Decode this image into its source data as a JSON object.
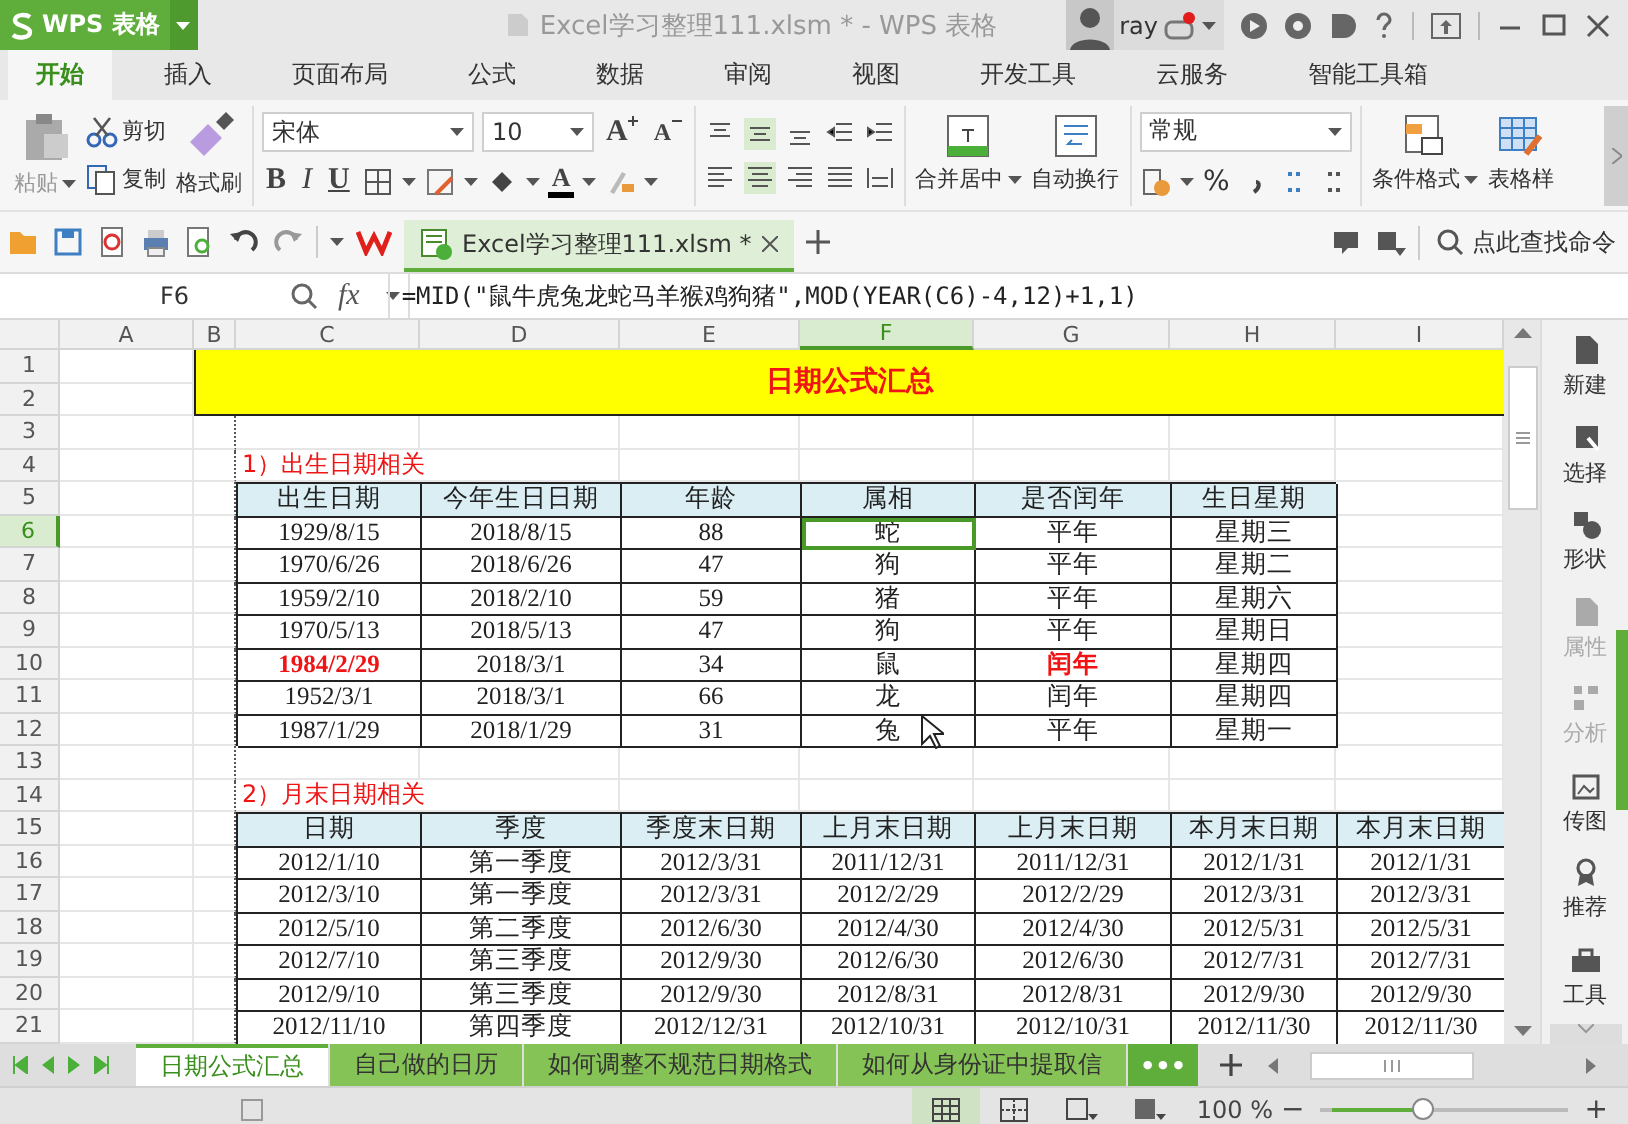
{
  "app": {
    "logo": "WPS 表格",
    "title": "Excel学习整理111.xlsm * - WPS 表格",
    "user": "ray"
  },
  "menu_tabs": [
    {
      "label": "开始",
      "selected": true
    },
    {
      "label": "插入",
      "selected": false
    },
    {
      "label": "页面布局",
      "selected": false
    },
    {
      "label": "公式",
      "selected": false
    },
    {
      "label": "数据",
      "selected": false
    },
    {
      "label": "审阅",
      "selected": false
    },
    {
      "label": "视图",
      "selected": false
    },
    {
      "label": "开发工具",
      "selected": false
    },
    {
      "label": "云服务",
      "selected": false
    },
    {
      "label": "智能工具箱",
      "selected": false
    }
  ],
  "ribbon": {
    "paste": "粘贴",
    "cut": "剪切",
    "copy": "复制",
    "format_painter": "格式刷",
    "font_name": "宋体",
    "font_size": "10",
    "grow_font": "A",
    "shrink_font": "A",
    "bold": "B",
    "italic": "I",
    "underline": "U",
    "font_color": "A",
    "merge_center": "合并居中",
    "wrap_text": "自动换行",
    "number_format": "常规",
    "percent": "%",
    "conditional_format": "条件格式",
    "table_style": "表格样"
  },
  "toolbar": {
    "document_tab": "Excel学习整理111.xlsm *",
    "search": "点此查找命令"
  },
  "formula_bar": {
    "cell": "F6",
    "fx": "fx",
    "formula": "=MID(\"鼠牛虎兔龙蛇马羊猴鸡狗猪\",MOD(YEAR(C6)-4,12)+1,1)"
  },
  "sheet": {
    "columns": [
      {
        "label": "A",
        "selected": false
      },
      {
        "label": "B",
        "selected": false
      },
      {
        "label": "C",
        "selected": false
      },
      {
        "label": "D",
        "selected": false
      },
      {
        "label": "E",
        "selected": false
      },
      {
        "label": "F",
        "selected": true
      },
      {
        "label": "G",
        "selected": false
      },
      {
        "label": "H",
        "selected": false
      },
      {
        "label": "I",
        "selected": false
      }
    ],
    "rows": [
      {
        "label": "1",
        "selected": false
      },
      {
        "label": "2",
        "selected": false
      },
      {
        "label": "3",
        "selected": false
      },
      {
        "label": "4",
        "selected": false
      },
      {
        "label": "5",
        "selected": false
      },
      {
        "label": "6",
        "selected": true
      },
      {
        "label": "7",
        "selected": false
      },
      {
        "label": "8",
        "selected": false
      },
      {
        "label": "9",
        "selected": false
      },
      {
        "label": "10",
        "selected": false
      },
      {
        "label": "11",
        "selected": false
      },
      {
        "label": "12",
        "selected": false
      },
      {
        "label": "13",
        "selected": false
      },
      {
        "label": "14",
        "selected": false
      },
      {
        "label": "15",
        "selected": false
      },
      {
        "label": "16",
        "selected": false
      },
      {
        "label": "17",
        "selected": false
      },
      {
        "label": "18",
        "selected": false
      },
      {
        "label": "19",
        "selected": false
      },
      {
        "label": "20",
        "selected": false
      },
      {
        "label": "21",
        "selected": false
      }
    ],
    "title": "日期公式汇总",
    "birthday_table": {
      "label": "1）出生日期相关",
      "headers": [
        "出生日期",
        "今年生日日期",
        "年龄",
        "属相",
        "是否闰年",
        "生日星期"
      ],
      "rows": [
        {
          "cells": [
            {
              "text": "1929/8/15",
              "highlighted": false,
              "selected": false
            },
            {
              "text": "2018/8/15",
              "highlighted": false,
              "selected": false
            },
            {
              "text": "88",
              "highlighted": false,
              "selected": false
            },
            {
              "text": "蛇",
              "highlighted": false,
              "selected": true
            },
            {
              "text": "平年",
              "highlighted": false,
              "selected": false
            },
            {
              "text": "星期三",
              "highlighted": false,
              "selected": false
            }
          ]
        },
        {
          "cells": [
            {
              "text": "1970/6/26",
              "highlighted": false,
              "selected": false
            },
            {
              "text": "2018/6/26",
              "highlighted": false,
              "selected": false
            },
            {
              "text": "47",
              "highlighted": false,
              "selected": false
            },
            {
              "text": "狗",
              "highlighted": false,
              "selected": false
            },
            {
              "text": "平年",
              "highlighted": false,
              "selected": false
            },
            {
              "text": "星期二",
              "highlighted": false,
              "selected": false
            }
          ]
        },
        {
          "cells": [
            {
              "text": "1959/2/10",
              "highlighted": false,
              "selected": false
            },
            {
              "text": "2018/2/10",
              "highlighted": false,
              "selected": false
            },
            {
              "text": "59",
              "highlighted": false,
              "selected": false
            },
            {
              "text": "猪",
              "highlighted": false,
              "selected": false
            },
            {
              "text": "平年",
              "highlighted": false,
              "selected": false
            },
            {
              "text": "星期六",
              "highlighted": false,
              "selected": false
            }
          ]
        },
        {
          "cells": [
            {
              "text": "1970/5/13",
              "highlighted": false,
              "selected": false
            },
            {
              "text": "2018/5/13",
              "highlighted": false,
              "selected": false
            },
            {
              "text": "47",
              "highlighted": false,
              "selected": false
            },
            {
              "text": "狗",
              "highlighted": false,
              "selected": false
            },
            {
              "text": "平年",
              "highlighted": false,
              "selected": false
            },
            {
              "text": "星期日",
              "highlighted": false,
              "selected": false
            }
          ]
        },
        {
          "cells": [
            {
              "text": "1984/2/29",
              "highlighted": true,
              "selected": false
            },
            {
              "text": "2018/3/1",
              "highlighted": false,
              "selected": false
            },
            {
              "text": "34",
              "highlighted": false,
              "selected": false
            },
            {
              "text": "鼠",
              "highlighted": false,
              "selected": false
            },
            {
              "text": "闰年",
              "highlighted": true,
              "selected": false
            },
            {
              "text": "星期四",
              "highlighted": false,
              "selected": false
            }
          ]
        },
        {
          "cells": [
            {
              "text": "1952/3/1",
              "highlighted": false,
              "selected": false
            },
            {
              "text": "2018/3/1",
              "highlighted": false,
              "selected": false
            },
            {
              "text": "66",
              "highlighted": false,
              "selected": false
            },
            {
              "text": "龙",
              "highlighted": false,
              "selected": false
            },
            {
              "text": "闰年",
              "highlighted": false,
              "selected": false
            },
            {
              "text": "星期四",
              "highlighted": false,
              "selected": false
            }
          ]
        },
        {
          "cells": [
            {
              "text": "1987/1/29",
              "highlighted": false,
              "selected": false
            },
            {
              "text": "2018/1/29",
              "highlighted": false,
              "selected": false
            },
            {
              "text": "31",
              "highlighted": false,
              "selected": false
            },
            {
              "text": "兔",
              "highlighted": false,
              "selected": false
            },
            {
              "text": "平年",
              "highlighted": false,
              "selected": false
            },
            {
              "text": "星期一",
              "highlighted": false,
              "selected": false
            }
          ]
        }
      ]
    },
    "month_end_table": {
      "label": "2）月末日期相关",
      "headers": [
        "日期",
        "季度",
        "季度末日期",
        "上月末日期",
        "上月末日期",
        "本月末日期",
        "本月末日期"
      ],
      "rows": [
        [
          "2012/1/10",
          "第一季度",
          "2012/3/31",
          "2011/12/31",
          "2011/12/31",
          "2012/1/31",
          "2012/1/31"
        ],
        [
          "2012/3/10",
          "第一季度",
          "2012/3/31",
          "2012/2/29",
          "2012/2/29",
          "2012/3/31",
          "2012/3/31"
        ],
        [
          "2012/5/10",
          "第二季度",
          "2012/6/30",
          "2012/4/30",
          "2012/4/30",
          "2012/5/31",
          "2012/5/31"
        ],
        [
          "2012/7/10",
          "第三季度",
          "2012/9/30",
          "2012/6/30",
          "2012/6/30",
          "2012/7/31",
          "2012/7/31"
        ],
        [
          "2012/9/10",
          "第三季度",
          "2012/9/30",
          "2012/8/31",
          "2012/8/31",
          "2012/9/30",
          "2012/9/30"
        ],
        [
          "2012/11/10",
          "第四季度",
          "2012/12/31",
          "2012/10/31",
          "2012/10/31",
          "2012/11/30",
          "2012/11/30"
        ]
      ]
    }
  },
  "sidebar": [
    {
      "label": "新建",
      "disabled": false
    },
    {
      "label": "选择",
      "disabled": false
    },
    {
      "label": "形状",
      "disabled": false
    },
    {
      "label": "属性",
      "disabled": true
    },
    {
      "label": "分析",
      "disabled": true
    },
    {
      "label": "传图",
      "disabled": false
    },
    {
      "label": "推荐",
      "disabled": false
    },
    {
      "label": "工具",
      "disabled": false
    }
  ],
  "sheet_tabs": [
    {
      "label": "日期公式汇总",
      "selected": true
    },
    {
      "label": "自己做的日历",
      "selected": false
    },
    {
      "label": "如何调整不规范日期格式",
      "selected": false
    },
    {
      "label": "如何从身份证中提取信",
      "selected": false
    }
  ],
  "more_tabs": "•••",
  "status_bar": {
    "zoom": "100 %",
    "zoom_out": "−",
    "zoom_in": "+",
    "zoom_slider": {
      "level": 0.4
    }
  }
}
